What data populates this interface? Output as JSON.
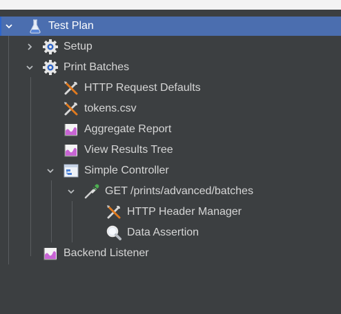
{
  "tree": {
    "nodes": [
      {
        "label": "Test Plan",
        "icon": "flask-icon",
        "expanded": true,
        "selected": true
      },
      {
        "label": "Setup",
        "icon": "gear-icon",
        "expanded": false
      },
      {
        "label": "Print Batches",
        "icon": "gear-icon",
        "expanded": true
      },
      {
        "label": "HTTP Request Defaults",
        "icon": "wrench-icon"
      },
      {
        "label": "tokens.csv",
        "icon": "wrench-icon"
      },
      {
        "label": "Aggregate Report",
        "icon": "chart-icon"
      },
      {
        "label": "View Results Tree",
        "icon": "chart-icon"
      },
      {
        "label": "Simple Controller",
        "icon": "controller-icon",
        "expanded": true
      },
      {
        "label": "GET /prints/advanced/batches",
        "icon": "pipette-icon",
        "expanded": true
      },
      {
        "label": "HTTP Header Manager",
        "icon": "wrench-icon"
      },
      {
        "label": "Data Assertion",
        "icon": "magnifier-icon"
      },
      {
        "label": "Backend Listener",
        "icon": "chart-icon"
      }
    ]
  },
  "colors": {
    "panel_background": "#3c3f41",
    "selection": "#4b6eaf",
    "text": "#d6d6d6"
  }
}
